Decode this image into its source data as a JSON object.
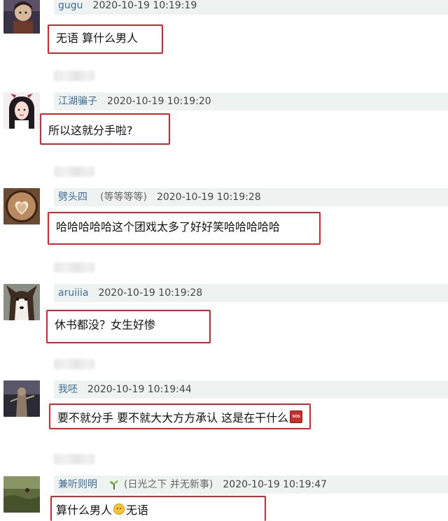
{
  "comments": [
    {
      "username": "gugu",
      "extra": "",
      "time": "2020-10-19 10:19:19",
      "text": "无语 算什么男人",
      "avatar": "dark-cartoon-portrait"
    },
    {
      "username": "江湖骗子",
      "extra": "",
      "time": "2020-10-19 10:19:20",
      "text": "所以这就分手啦?",
      "avatar": "anime-girl-with-bow"
    },
    {
      "username": "劈头四",
      "extra": "(等等等等)",
      "time": "2020-10-19 10:19:28",
      "text": "哈哈哈哈哈这个团戏太多了好好笑哈哈哈哈哈",
      "avatar": "latte-art-heart"
    },
    {
      "username": "aruiiia",
      "extra": "",
      "time": "2020-10-19 10:19:28",
      "text": "休书都没？女生好惨",
      "avatar": "husky-dog"
    },
    {
      "username": "我呸",
      "extra": "",
      "time": "2020-10-19 10:19:44",
      "text": "要不就分手 要不就大大方方承认 这是在干什么",
      "avatar": "dark-statue"
    },
    {
      "username": "兼听则明",
      "extra": "(日光之下 并无新事)",
      "time": "2020-10-19 10:19:47",
      "text_before": "算什么男人",
      "text_after": "无语",
      "avatar": "green-landscape"
    }
  ],
  "emoji": {
    "sos": "SOS"
  },
  "colors": {
    "highlight_border": "#e0222d",
    "meta_bg": "#eef2f0",
    "username": "#3c6e9b"
  }
}
